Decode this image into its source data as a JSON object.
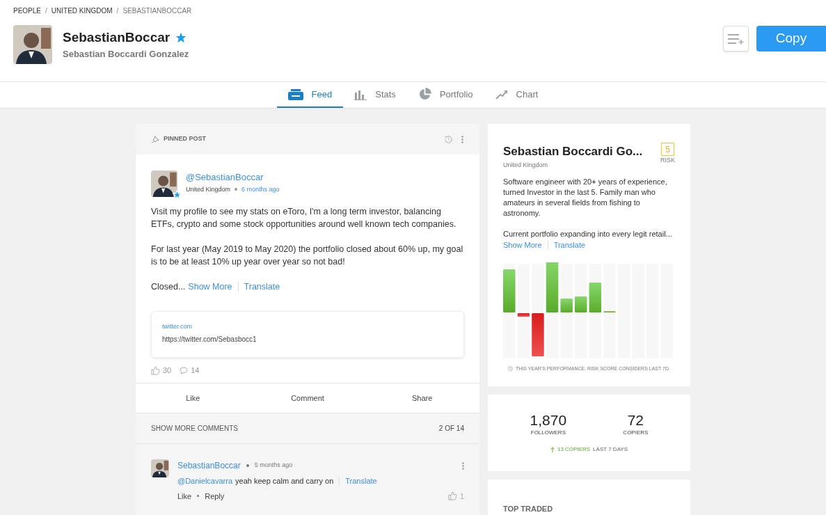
{
  "breadcrumb": [
    "PEOPLE",
    "UNITED KINGDOM",
    "SEBASTIANBOCCAR"
  ],
  "breadcrumb_separator": "/",
  "header": {
    "username": "SebastianBoccar",
    "full_name": "Sebastian Boccardi Gonzalez",
    "verified": true,
    "copy_button": "Copy"
  },
  "tabs": [
    {
      "label": "Feed",
      "kind": "feed",
      "selected": true
    },
    {
      "label": "Stats",
      "kind": "stats",
      "selected": false
    },
    {
      "label": "Portfolio",
      "kind": "portfolio",
      "selected": false
    },
    {
      "label": "Chart",
      "kind": "chart",
      "selected": false
    }
  ],
  "post": {
    "pinned_label": "PINNED POST",
    "author": "@SebastianBoccar",
    "country": "United Kingdom",
    "time": "6 months ago",
    "paragraphs": [
      "Visit my profile to see my stats on eToro, I'm a long term investor, balancing ETFs, crypto and some stock opportunities around well known tech companies.",
      "For last year (May 2019 to May 2020) the portfolio closed about 60% up, my goal is to be at least 10% up year over year so not bad!"
    ],
    "truncated": "Closed...",
    "show_more": "Show More",
    "translate": "Translate",
    "link": {
      "domain": "twitter.com",
      "url": "https://twitter.com/Sebasbocc1"
    },
    "likes": "30",
    "comments": "14",
    "actions": [
      "Like",
      "Comment",
      "Share"
    ],
    "show_more_comments": "SHOW MORE COMMENTS",
    "comment_count": "2 OF 14",
    "comment": {
      "author": "SebastianBoccar",
      "time": "5 months ago",
      "mention": "@Danielcavarra",
      "text": "yeah keep calm and carry on",
      "translate": "Translate",
      "like": "Like",
      "reply": "Reply",
      "likes": "1"
    }
  },
  "profile_card": {
    "name": "Sebastian Boccardi Go...",
    "country": "United Kingdom",
    "risk": "5",
    "risk_label": "RISK",
    "bio": "Software engineer with 20+ years of experience, turned Investor in the last 5. Family man who amateurs in several fields from fishing to astronomy.",
    "bio_more": "Current portfolio expanding into every legit retail...",
    "show_more": "Show More",
    "translate": "Translate",
    "chart_note": "THIS YEAR'S PERFORMANCE. RISK SCORE CONSIDERS LAST 7D."
  },
  "stats_card": {
    "followers": "1,870",
    "followers_label": "FOLLOWERS",
    "copiers": "72",
    "copiers_label": "COPIERS",
    "trend_count": "13 COPIERS",
    "trend_rest": "LAST 7 DAYS"
  },
  "top_traded": {
    "title": "TOP TRADED"
  }
}
